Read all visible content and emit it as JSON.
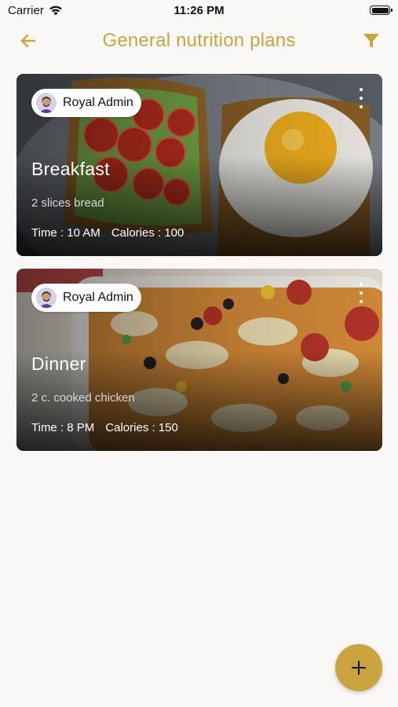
{
  "status_bar": {
    "carrier": "Carrier",
    "time": "11:26 PM"
  },
  "header": {
    "title": "General nutrition plans"
  },
  "colors": {
    "accent": "#c9a440",
    "background": "#faf8f6"
  },
  "icons": {
    "back": "arrow-left-icon",
    "filter": "funnel-icon",
    "more": "more-vertical-icon",
    "add": "plus-icon",
    "wifi": "wifi-icon",
    "battery": "battery-icon"
  },
  "plans": [
    {
      "author": "Royal Admin",
      "title": "Breakfast",
      "description": "2 slices bread",
      "time": "Time : 10 AM",
      "calories": "Calories : 100"
    },
    {
      "author": "Royal Admin",
      "title": "Dinner",
      "description": "2 c. cooked chicken",
      "time": "Time : 8 PM",
      "calories": "Calories : 150"
    }
  ]
}
